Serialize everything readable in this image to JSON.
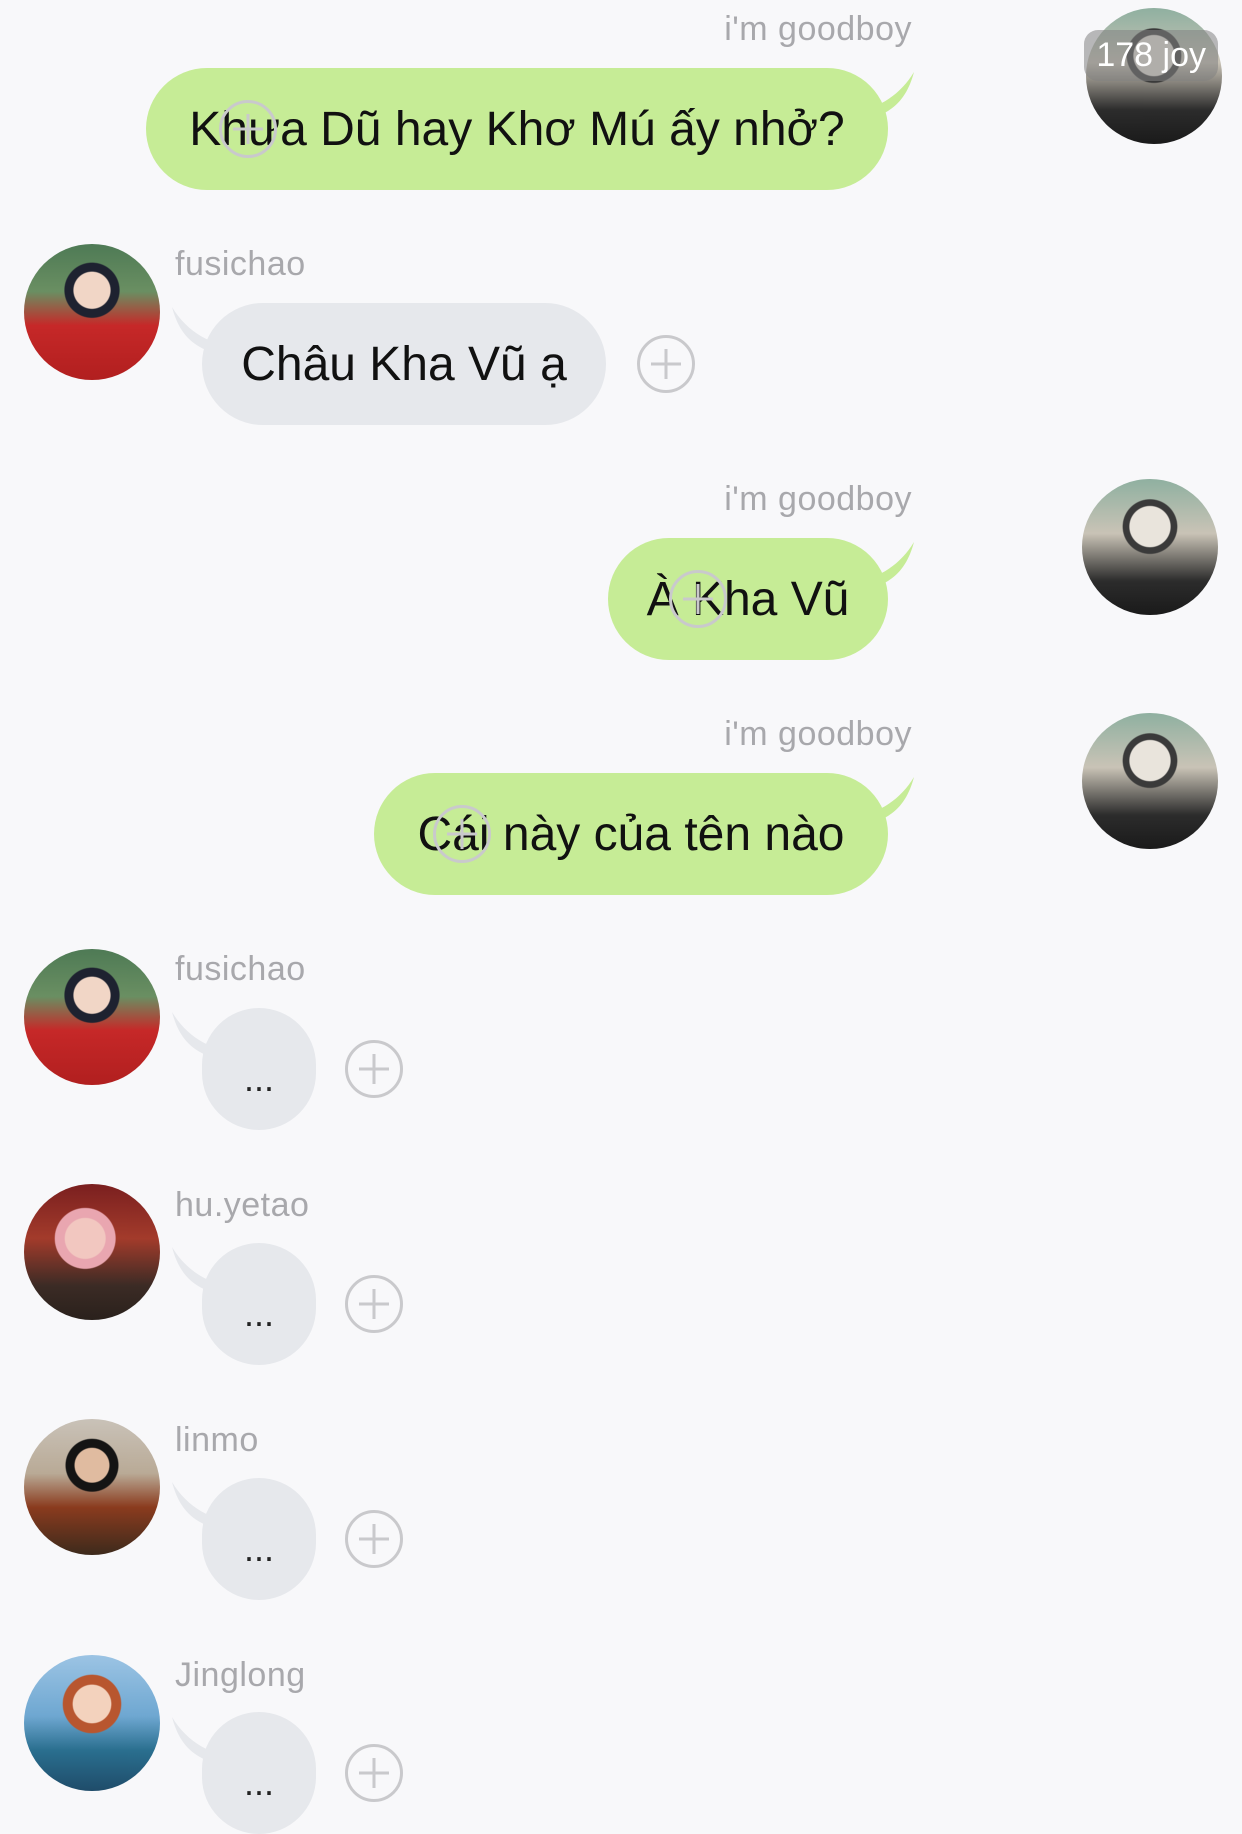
{
  "badge": {
    "text": "178 joy"
  },
  "users": {
    "goodboy": "i'm goodboy",
    "fusichao": "fusichao",
    "huyetao": "hu.yetao",
    "linmo": "linmo",
    "jinglong": "Jinglong"
  },
  "messages": [
    {
      "sender": "i'm goodboy",
      "text": "Khưa Dũ hay Khơ Mú ấy nhở?"
    },
    {
      "sender": "fusichao",
      "text": "Châu Kha Vũ ạ"
    },
    {
      "sender": "i'm goodboy",
      "text": "À Kha Vũ"
    },
    {
      "sender": "i'm goodboy",
      "text": "Cái này của tên nào"
    },
    {
      "sender": "fusichao",
      "text": "..."
    },
    {
      "sender": "hu.yetao",
      "text": "..."
    },
    {
      "sender": "linmo",
      "text": "..."
    },
    {
      "sender": "Jinglong",
      "text": "..."
    }
  ],
  "colors": {
    "outgoing_bubble": "#c6ec96",
    "incoming_bubble": "#e6e8ec",
    "background": "#f8f8fa",
    "name_text": "#a8a8ac"
  },
  "icons": {
    "add_reaction": "plus-circle-icon"
  }
}
